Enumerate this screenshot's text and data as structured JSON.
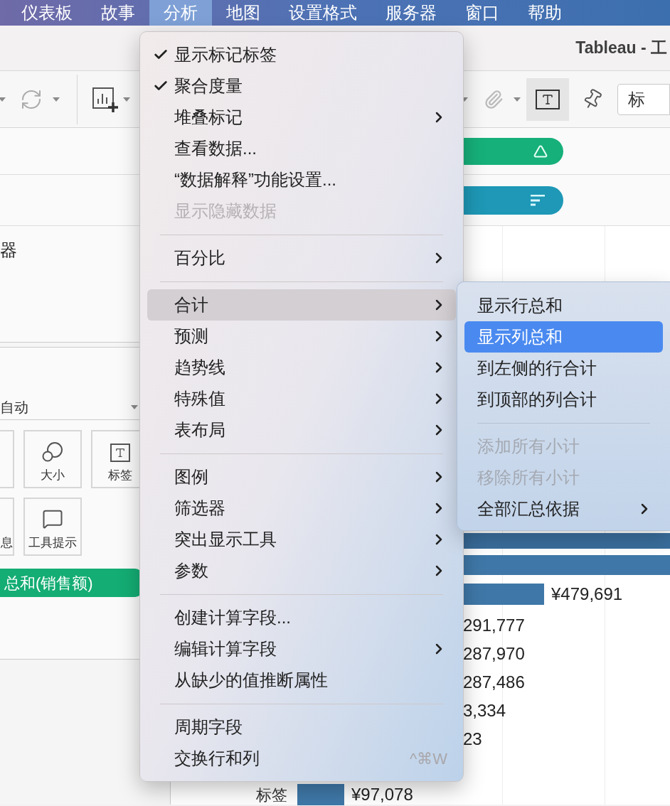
{
  "menubar": {
    "items": [
      {
        "label": "仪表板",
        "selected": false
      },
      {
        "label": "故事",
        "selected": false
      },
      {
        "label": "分析",
        "selected": true
      },
      {
        "label": "地图",
        "selected": false
      },
      {
        "label": "设置格式",
        "selected": false
      },
      {
        "label": "服务器",
        "selected": false
      },
      {
        "label": "窗口",
        "selected": false
      },
      {
        "label": "帮助",
        "selected": false
      }
    ]
  },
  "window": {
    "title": "Tableau - 工"
  },
  "toolbar": {
    "labels_button": {
      "on": true
    },
    "field_text": "标"
  },
  "left_panel": {
    "filter_card_text": "器",
    "marks": {
      "type_dropdown": "自动",
      "buttons": [
        {
          "label": "大小",
          "kind": "size"
        },
        {
          "label": "标签",
          "kind": "label"
        },
        {
          "label": "息",
          "kind": "detail"
        },
        {
          "label": "工具提示",
          "kind": "tooltip"
        }
      ],
      "pill": "总和(销售额)"
    }
  },
  "view": {
    "rows": [
      {
        "kind": "bar_only"
      },
      {
        "kind": "bar_only"
      },
      {
        "kind": "bar",
        "value": "¥479,691"
      },
      {
        "kind": "value",
        "value": "291,777"
      },
      {
        "kind": "value",
        "value": "287,970"
      },
      {
        "kind": "value",
        "value": "287,486"
      },
      {
        "kind": "value",
        "value": "3,334"
      },
      {
        "kind": "value",
        "value": "23"
      }
    ],
    "bottom_row": {
      "header": "标签",
      "value": "¥97,078"
    }
  },
  "menu": {
    "items": [
      {
        "kind": "action",
        "label": "显示标记标签",
        "checked": true,
        "disabled": false,
        "selected": false
      },
      {
        "kind": "action",
        "label": "聚合度量",
        "checked": true,
        "disabled": false,
        "selected": false
      },
      {
        "kind": "submenu",
        "label": "堆叠标记",
        "checked": false,
        "disabled": false,
        "selected": false
      },
      {
        "kind": "action",
        "label": "查看数据...",
        "checked": false,
        "disabled": false,
        "selected": false
      },
      {
        "kind": "action",
        "label": "“数据解释”功能设置...",
        "checked": false,
        "disabled": false,
        "selected": false
      },
      {
        "kind": "action",
        "label": "显示隐藏数据",
        "checked": false,
        "disabled": true,
        "selected": false
      },
      {
        "kind": "separator"
      },
      {
        "kind": "submenu",
        "label": "百分比",
        "checked": false,
        "disabled": false,
        "selected": false
      },
      {
        "kind": "separator"
      },
      {
        "kind": "submenu",
        "label": "合计",
        "checked": false,
        "disabled": false,
        "selected": true
      },
      {
        "kind": "submenu",
        "label": "预测",
        "checked": false,
        "disabled": false,
        "selected": false
      },
      {
        "kind": "submenu",
        "label": "趋势线",
        "checked": false,
        "disabled": false,
        "selected": false
      },
      {
        "kind": "submenu",
        "label": "特殊值",
        "checked": false,
        "disabled": false,
        "selected": false
      },
      {
        "kind": "submenu",
        "label": "表布局",
        "checked": false,
        "disabled": false,
        "selected": false
      },
      {
        "kind": "separator"
      },
      {
        "kind": "submenu",
        "label": "图例",
        "checked": false,
        "disabled": false,
        "selected": false
      },
      {
        "kind": "submenu",
        "label": "筛选器",
        "checked": false,
        "disabled": false,
        "selected": false
      },
      {
        "kind": "submenu",
        "label": "突出显示工具",
        "checked": false,
        "disabled": false,
        "selected": false
      },
      {
        "kind": "submenu",
        "label": "参数",
        "checked": false,
        "disabled": false,
        "selected": false
      },
      {
        "kind": "separator"
      },
      {
        "kind": "action",
        "label": "创建计算字段...",
        "checked": false,
        "disabled": false,
        "selected": false
      },
      {
        "kind": "submenu",
        "label": "编辑计算字段",
        "checked": false,
        "disabled": false,
        "selected": false
      },
      {
        "kind": "action",
        "label": "从缺少的值推断属性",
        "checked": false,
        "disabled": false,
        "selected": false
      },
      {
        "kind": "separator"
      },
      {
        "kind": "action",
        "label": "周期字段",
        "checked": false,
        "disabled": false,
        "selected": false
      },
      {
        "kind": "action",
        "label": "交换行和列",
        "checked": false,
        "disabled": false,
        "selected": false,
        "shortcut": "^⌘W"
      }
    ]
  },
  "submenu": {
    "items": [
      {
        "kind": "action",
        "label": "显示行总和",
        "disabled": false,
        "selected": false
      },
      {
        "kind": "action",
        "label": "显示列总和",
        "disabled": false,
        "selected": true
      },
      {
        "kind": "action",
        "label": "到左侧的行合计",
        "disabled": false,
        "selected": false
      },
      {
        "kind": "action",
        "label": "到顶部的列合计",
        "disabled": false,
        "selected": false
      },
      {
        "kind": "separator"
      },
      {
        "kind": "action",
        "label": "添加所有小计",
        "disabled": true,
        "selected": false
      },
      {
        "kind": "action",
        "label": "移除所有小计",
        "disabled": true,
        "selected": false
      },
      {
        "kind": "submenu",
        "label": "全部汇总依据",
        "disabled": false,
        "selected": false
      }
    ]
  }
}
